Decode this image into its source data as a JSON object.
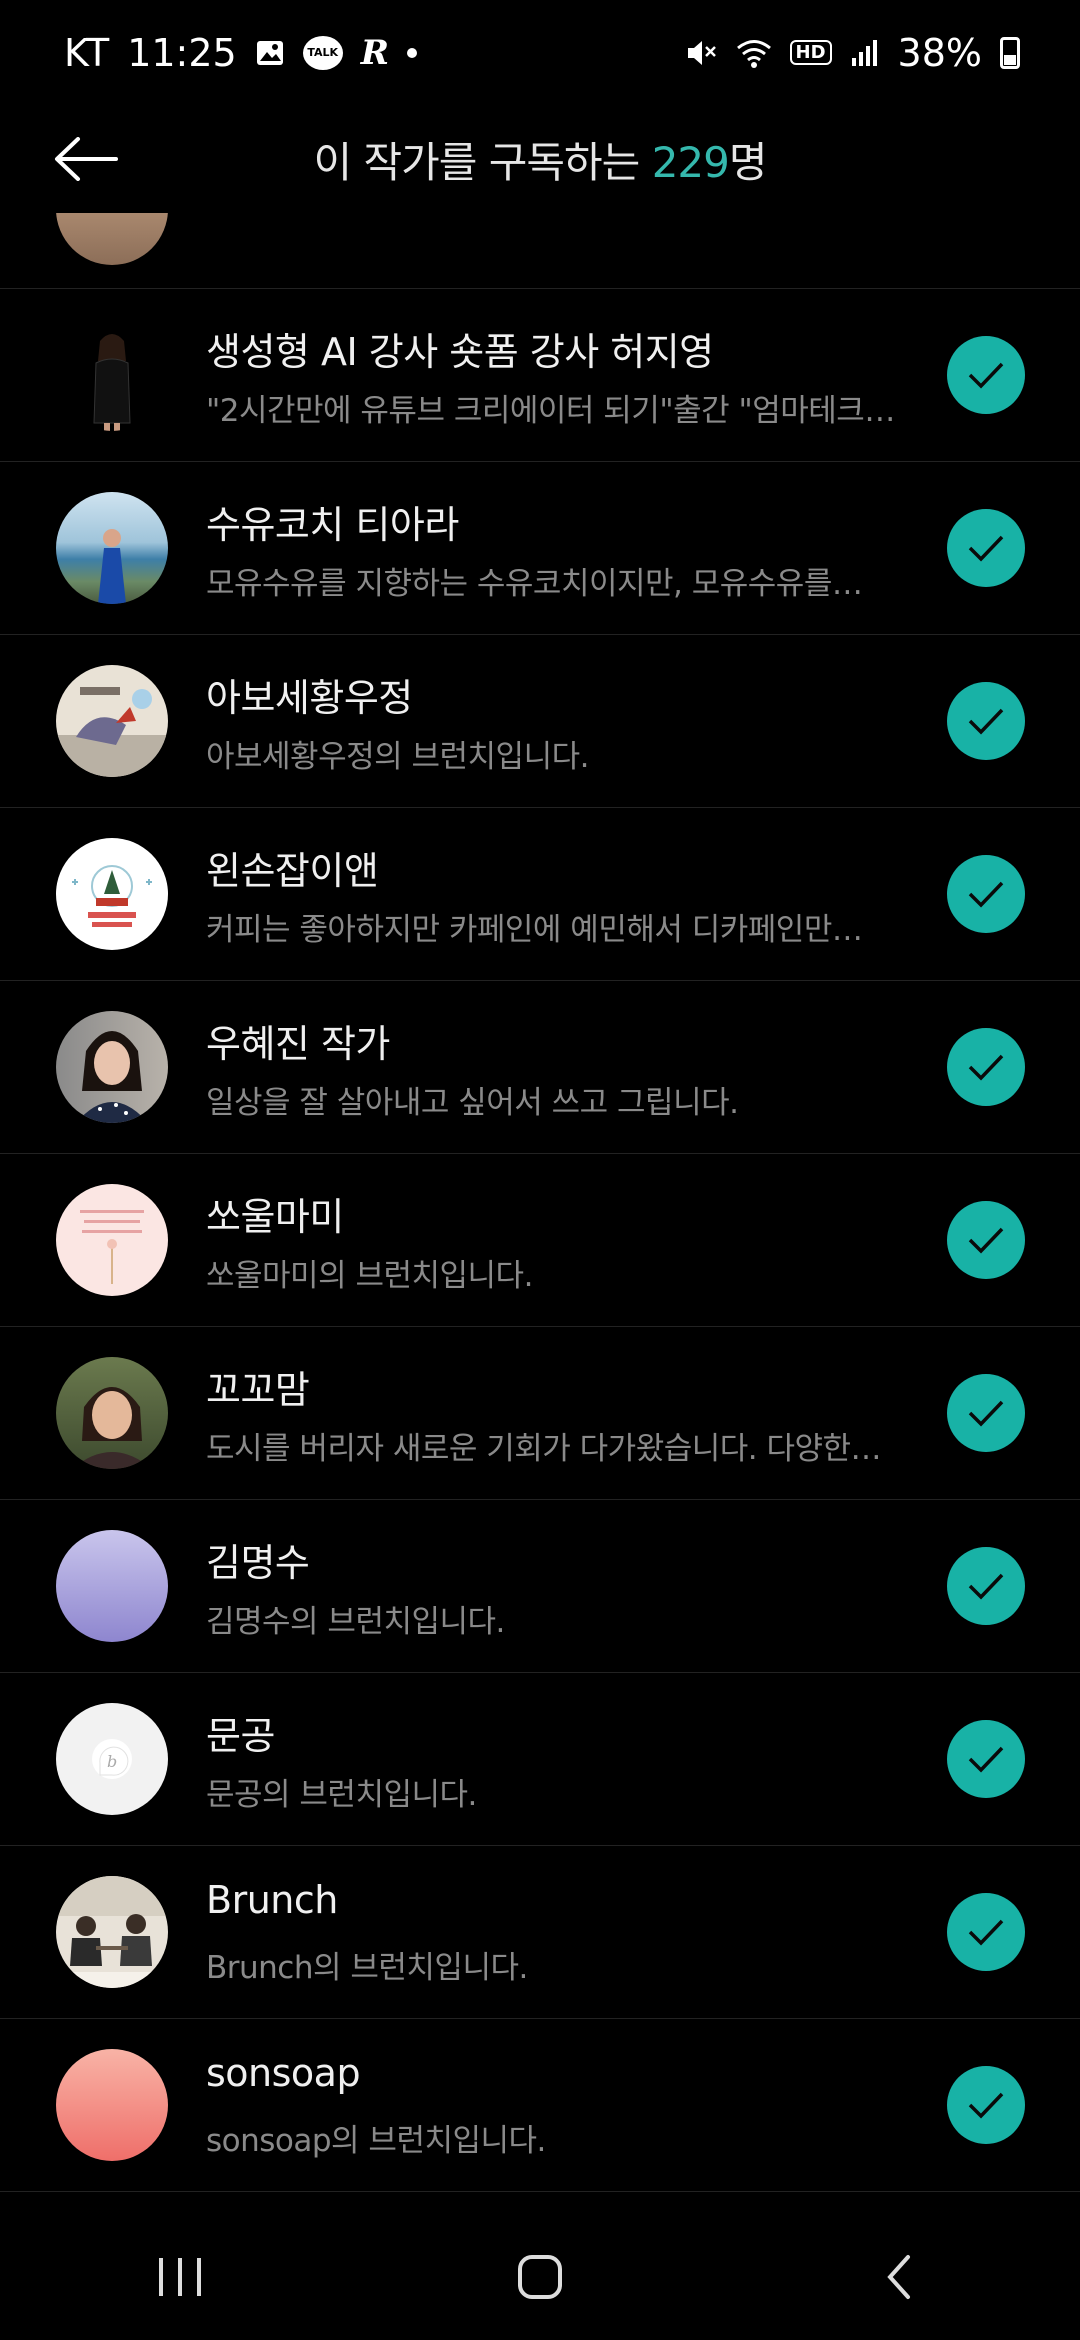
{
  "status_bar": {
    "carrier": "KT",
    "time": "11:25",
    "talk_label": "TALK",
    "r_icon_text": "R",
    "hd_label": "HD",
    "battery": "38%"
  },
  "header": {
    "title_prefix": "이 작가를 구독하는 ",
    "count": "229",
    "title_suffix": "명"
  },
  "list": [
    {
      "name": "생성형 AI 강사 숏폼 강사 허지영",
      "desc": "\"2시간만에 유튜브 크리에이터 되기\"출간 \"엄마테크…",
      "avatar": "photo-dark-figure"
    },
    {
      "name": "수유코치 티아라",
      "desc": "모유수유를 지향하는 수유코치이지만, 모유수유를…",
      "avatar": "photo-sea"
    },
    {
      "name": "아보세황우정",
      "desc": "아보세황우정의 브런치입니다.",
      "avatar": "illustration"
    },
    {
      "name": "왼손잡이앤",
      "desc": "커피는 좋아하지만 카페인에 예민해서 디카페인만…",
      "avatar": "christmas"
    },
    {
      "name": "우혜진 작가",
      "desc": "일상을 잘 살아내고 싶어서 쓰고 그립니다.",
      "avatar": "photo-woman"
    },
    {
      "name": "쏘울마미",
      "desc": "쏘울마미의 브런치입니다.",
      "avatar": "pink-flower"
    },
    {
      "name": "꼬꼬맘",
      "desc": "도시를 버리자 새로운 기회가 다가왔습니다. 다양한…",
      "avatar": "photo-woman2"
    },
    {
      "name": "김명수",
      "desc": "김명수의 브런치입니다.",
      "avatar": "lavender-gradient"
    },
    {
      "name": "문공",
      "desc": "문공의 브런치입니다.",
      "avatar": "brunch-default"
    },
    {
      "name": "Brunch",
      "desc": "Brunch의 브런치입니다.",
      "avatar": "photo-people"
    },
    {
      "name": "sonsoap",
      "desc": "sonsoap의 브런치입니다.",
      "avatar": "coral-gradient"
    }
  ],
  "colors": {
    "accent": "#35b8ad",
    "check_bg": "#18b2a6",
    "background": "#000000",
    "desc_text": "#8a8a8a"
  }
}
